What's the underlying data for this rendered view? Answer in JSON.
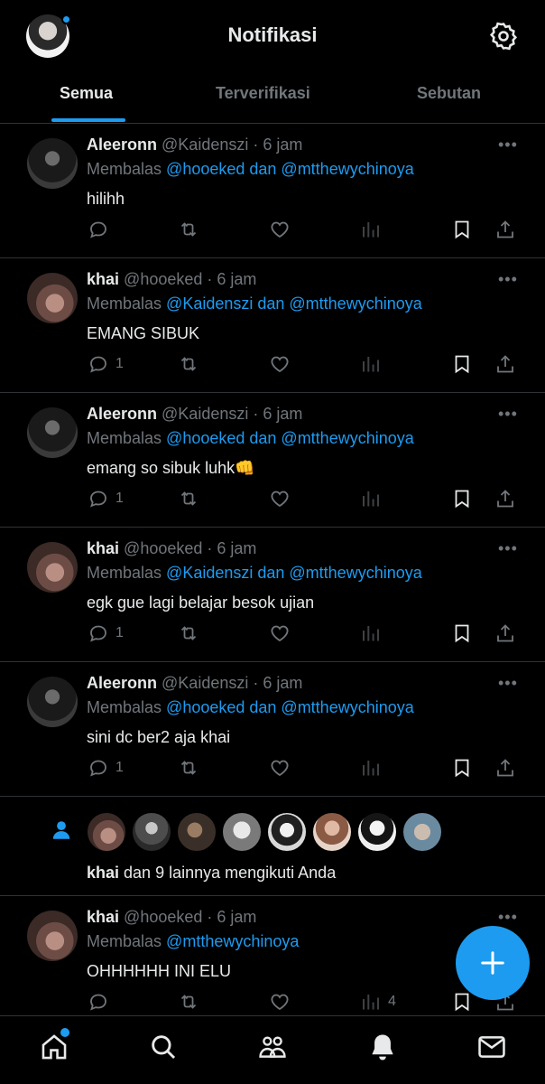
{
  "header": {
    "title": "Notifikasi"
  },
  "tabs": [
    {
      "label": "Semua"
    },
    {
      "label": "Terverifikasi"
    },
    {
      "label": "Sebutan"
    }
  ],
  "notifications": [
    {
      "name": "Aleeronn",
      "handle": "@Kaidenszi",
      "time": "· 6 jam",
      "reply_prefix": "Membalas",
      "reply_to": "@hooeked dan @mtthewychinoya",
      "text": "hilihh",
      "reply_count": "",
      "views": ""
    },
    {
      "name": "khai",
      "handle": "@hooeked",
      "time": "· 6 jam",
      "reply_prefix": "Membalas",
      "reply_to": "@Kaidenszi dan @mtthewychinoya",
      "text": "EMANG SIBUK",
      "reply_count": "1",
      "views": ""
    },
    {
      "name": "Aleeronn",
      "handle": "@Kaidenszi",
      "time": "· 6 jam",
      "reply_prefix": "Membalas",
      "reply_to": "@hooeked dan @mtthewychinoya",
      "text": "emang so sibuk luhk👊",
      "reply_count": "1",
      "views": ""
    },
    {
      "name": "khai",
      "handle": "@hooeked",
      "time": "· 6 jam",
      "reply_prefix": "Membalas",
      "reply_to": "@Kaidenszi dan @mtthewychinoya",
      "text": "egk gue lagi belajar besok ujian",
      "reply_count": "1",
      "views": ""
    },
    {
      "name": "Aleeronn",
      "handle": "@Kaidenszi",
      "time": "· 6 jam",
      "reply_prefix": "Membalas",
      "reply_to": "@hooeked dan @mtthewychinoya",
      "text": "sini dc ber2 aja khai",
      "reply_count": "1",
      "views": ""
    }
  ],
  "follow": {
    "name": "khai",
    "rest": " dan 9 lainnya mengikuti Anda"
  },
  "last": {
    "name": "khai",
    "handle": "@hooeked",
    "time": "· 6 jam",
    "reply_prefix": "Membalas",
    "reply_to": "@mtthewychinoya",
    "text": "OHHHHHH INI ELU",
    "reply_count": "",
    "views": "4"
  },
  "more_label": "•••",
  "colors": {
    "accent": "#1d9bf0",
    "muted": "#71767b",
    "text": "#e7e9ea",
    "divider": "#2f3336"
  }
}
